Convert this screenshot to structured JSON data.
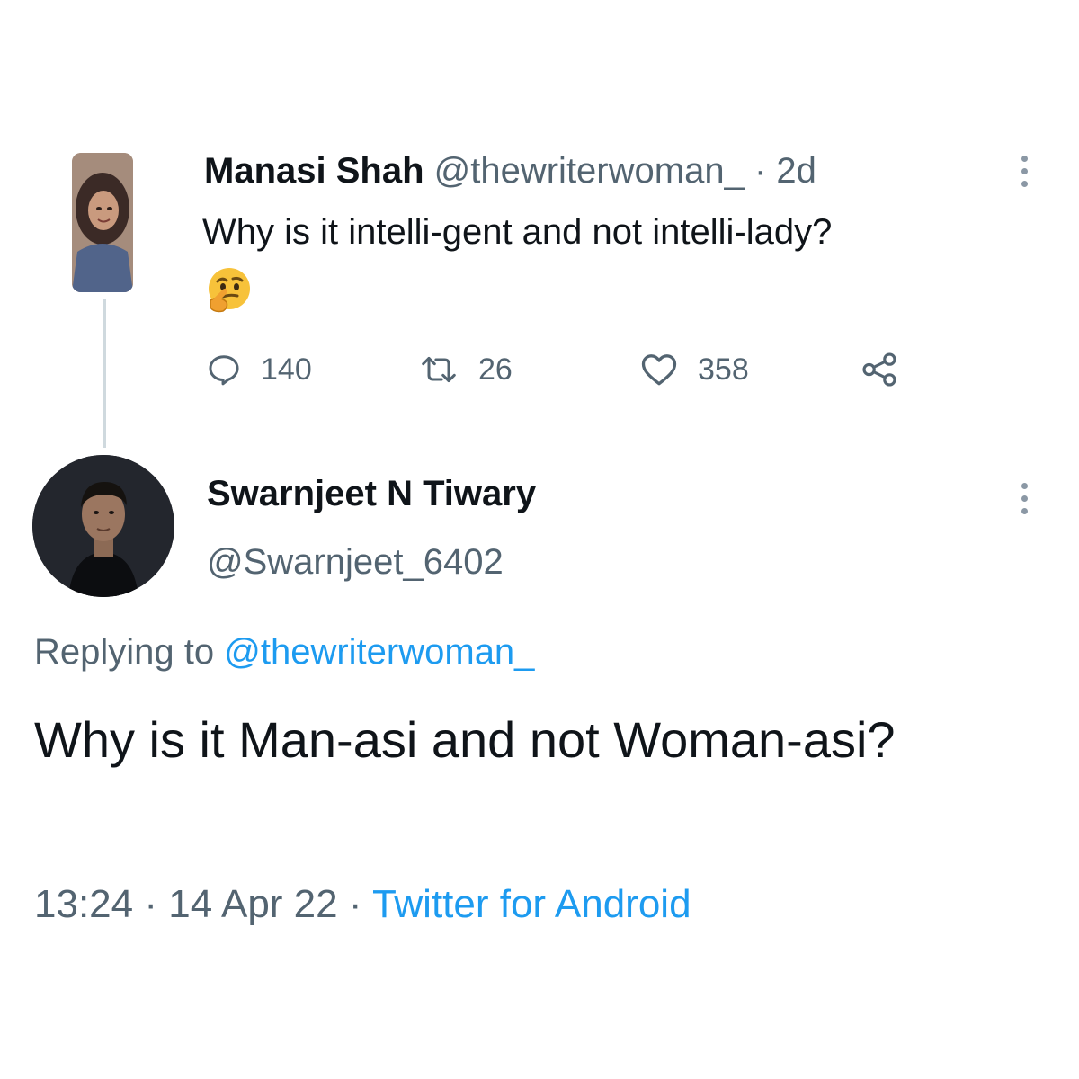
{
  "original_tweet": {
    "author_name": "Manasi Shah",
    "handle": "@thewriterwoman_",
    "separator": "·",
    "time_ago": "2d",
    "text": "Why is it intelli-gent and not intelli-lady?",
    "emoji": "thinking-face",
    "actions": {
      "replies": "140",
      "retweets": "26",
      "likes": "358"
    }
  },
  "reply_tweet": {
    "author_name": "Swarnjeet N Tiwary",
    "handle": "@Swarnjeet_6402",
    "replying_prefix": "Replying to",
    "replying_to": "@thewriterwoman_",
    "text": "Why is it Man-asi and not Woman-asi?",
    "time": "13:24",
    "date": "14 Apr 22",
    "separator": "·",
    "source": "Twitter for Android"
  },
  "colors": {
    "text": "#0f1419",
    "muted": "#536471",
    "link": "#1d9bf0",
    "thread_line": "#cfd9de"
  }
}
